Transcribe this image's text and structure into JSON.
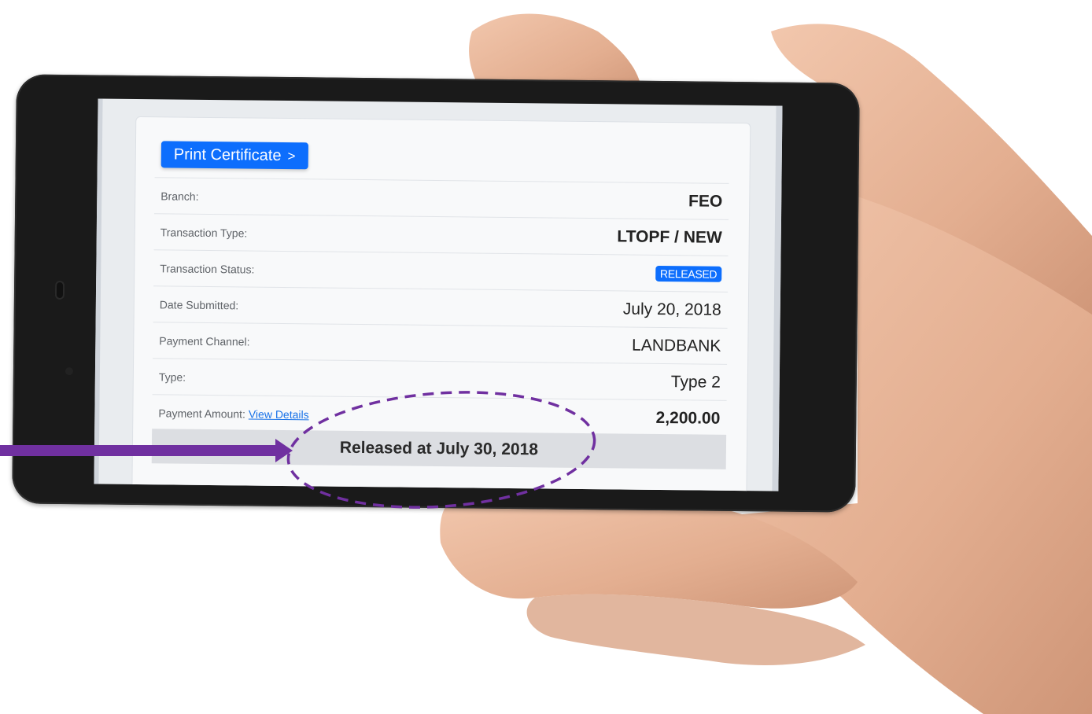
{
  "certificate": {
    "print_button": "Print Certificate",
    "print_chevron": ">"
  },
  "details": [
    {
      "label": "Branch:",
      "value": "FEO"
    },
    {
      "label": "Transaction Type:",
      "value": "LTOPF / NEW"
    },
    {
      "label": "Transaction Status:",
      "value": "RELEASED"
    },
    {
      "label": "Date Submitted:",
      "value": "July 20, 2018"
    },
    {
      "label": "Payment Channel:",
      "value": "LANDBANK"
    },
    {
      "label": "Type:",
      "value": "Type 2"
    },
    {
      "label": "Payment Amount:",
      "link": "View Details",
      "value": "2,200.00"
    }
  ],
  "released_banner": "Released at July 30, 2018",
  "colors": {
    "primary": "#0d6efd",
    "annotation": "#7030a0",
    "phone_body": "#1a1a1a",
    "skin": "#e8b596"
  },
  "icons": {
    "chevron": "chevron-right-icon",
    "arrow": "arrow-right-icon",
    "highlight": "dashed-ellipse"
  }
}
